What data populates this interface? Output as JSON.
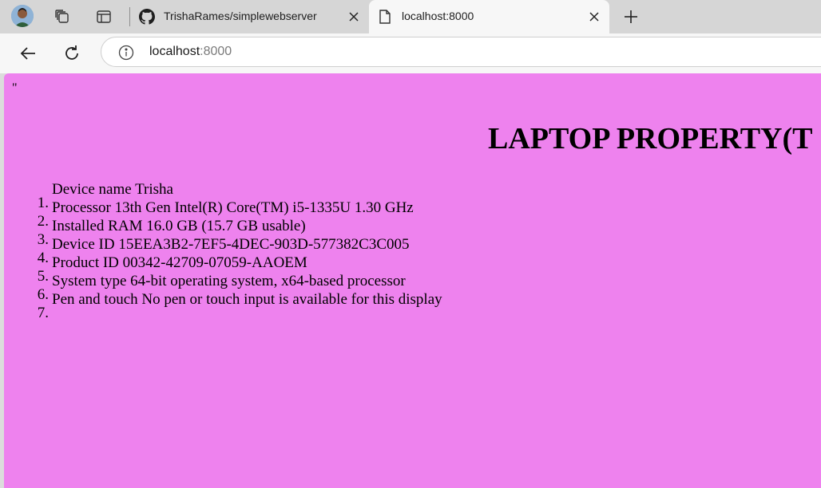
{
  "browser": {
    "tabs": [
      {
        "title": "TrishaRames/simplewebserver",
        "icon": "github-icon",
        "active": false
      },
      {
        "title": "localhost:8000",
        "icon": "page-icon",
        "active": true
      }
    ],
    "address": {
      "host": "localhost",
      "port": ":8000"
    }
  },
  "page": {
    "stray_text": "\"",
    "heading": "LAPTOP PROPERTY(T",
    "properties": [
      {
        "num": "1.",
        "text": "Device name Trisha"
      },
      {
        "num": "2.",
        "text": "Processor 13th Gen Intel(R) Core(TM) i5-1335U 1.30 GHz"
      },
      {
        "num": "3.",
        "text": "Installed RAM 16.0 GB (15.7 GB usable)"
      },
      {
        "num": "4.",
        "text": "Device ID 15EEA3B2-7EF5-4DEC-903D-577382C3C005"
      },
      {
        "num": "5.",
        "text": "Product ID 00342-42709-07059-AAOEM"
      },
      {
        "num": "6.",
        "text": "System type 64-bit operating system, x64-based processor"
      },
      {
        "num": "7.",
        "text": "Pen and touch No pen or touch input is available for this display"
      }
    ],
    "background_color": "#ee82ee"
  }
}
